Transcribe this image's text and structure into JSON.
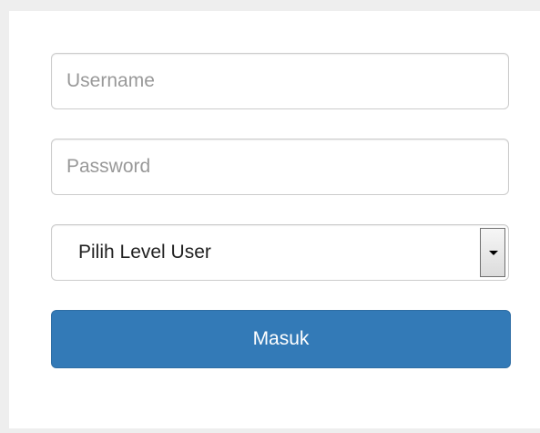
{
  "form": {
    "username": {
      "value": "",
      "placeholder": "Username"
    },
    "password": {
      "value": "",
      "placeholder": "Password"
    },
    "level": {
      "selected": "Pilih Level User"
    },
    "submit_label": "Masuk"
  },
  "colors": {
    "primary": "#337ab7",
    "border": "#cccccc",
    "placeholder": "#999999",
    "background": "#eeeeee"
  },
  "icons": {
    "select_arrow": "chevron-down-icon"
  }
}
